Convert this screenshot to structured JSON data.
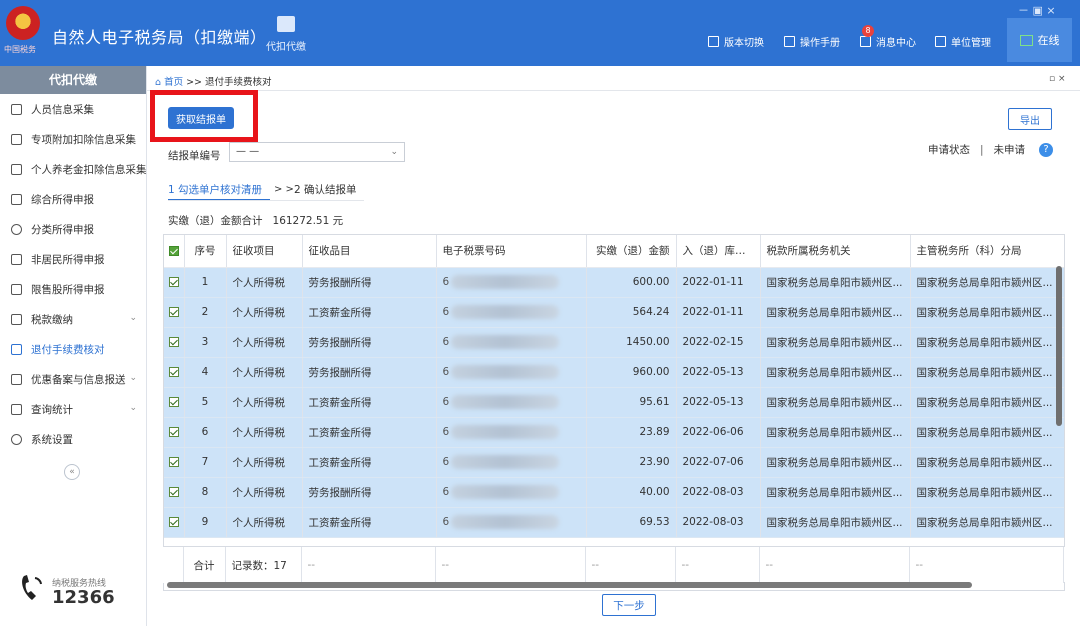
{
  "header": {
    "app_title": "自然人电子税务局（扣缴端）",
    "logo_text": "中国税务",
    "nav_tab": "代扣代缴",
    "version_switch": "版本切换",
    "manual": "操作手册",
    "messages": "消息中心",
    "message_count": "8",
    "unit_mgmt": "单位管理",
    "online": "在线",
    "win_controls": "－ ▣ ×",
    "colors": {
      "bar": "#2e72d2",
      "badge": "#e8413d"
    }
  },
  "sidebar": {
    "title": "代扣代缴",
    "items": [
      {
        "label": "人员信息采集",
        "icon": "person-icon"
      },
      {
        "label": "专项附加扣除信息采集",
        "icon": "list-icon"
      },
      {
        "label": "个人养老金扣除信息采集",
        "icon": "card-icon"
      },
      {
        "label": "综合所得申报",
        "icon": "layers-icon"
      },
      {
        "label": "分类所得申报",
        "icon": "clock-icon"
      },
      {
        "label": "非居民所得申报",
        "icon": "user-icon"
      },
      {
        "label": "限售股所得申报",
        "icon": "bar-chart-icon"
      },
      {
        "label": "税款缴纳",
        "icon": "wallet-icon"
      },
      {
        "label": "退付手续费核对",
        "icon": "doc-icon"
      },
      {
        "label": "优惠备案与信息报送",
        "icon": "folder-icon"
      },
      {
        "label": "查询统计",
        "icon": "search-list-icon"
      },
      {
        "label": "系统设置",
        "icon": "gear-icon"
      }
    ],
    "collapse": "«",
    "hotline_label": "纳税服务热线",
    "hotline_number": "12366"
  },
  "main": {
    "breadcrumb_home": "首页",
    "breadcrumb_sep": " >> ",
    "breadcrumb_current": "退付手续费核对",
    "window_controls": "▫ ×",
    "fetch_button": "获取结报单",
    "export_button": "导出",
    "report_no_label": "结报单编号",
    "report_no_value": "— —",
    "status_label": "申请状态",
    "status_value": "未申请",
    "help": "?",
    "step1": "1 勾选单户核对清册",
    "step_arrow": "> >",
    "step2": "2 确认结报单",
    "total_label": "实缴（退）金额合计",
    "total_value": "161272.51 元",
    "next_button": "下一步"
  },
  "table": {
    "columns": [
      "序号",
      "征收项目",
      "征收品目",
      "电子税票号码",
      "实缴（退）金额",
      "入（退）库日期",
      "税款所属税务机关",
      "主管税务所（科）分局"
    ],
    "rows": [
      {
        "no": "1",
        "item": "个人所得税",
        "sub": "劳务报酬所得",
        "ticket": "6",
        "amount": "600.00",
        "date": "2022-01-11",
        "office": "国家税务总局阜阳市颍州区...",
        "branch": "国家税务总局阜阳市颍州区..."
      },
      {
        "no": "2",
        "item": "个人所得税",
        "sub": "工资薪金所得",
        "ticket": "6",
        "amount": "564.24",
        "date": "2022-01-11",
        "office": "国家税务总局阜阳市颍州区...",
        "branch": "国家税务总局阜阳市颍州区..."
      },
      {
        "no": "3",
        "item": "个人所得税",
        "sub": "劳务报酬所得",
        "ticket": "6",
        "amount": "1450.00",
        "date": "2022-02-15",
        "office": "国家税务总局阜阳市颍州区...",
        "branch": "国家税务总局阜阳市颍州区..."
      },
      {
        "no": "4",
        "item": "个人所得税",
        "sub": "劳务报酬所得",
        "ticket": "6",
        "amount": "960.00",
        "date": "2022-05-13",
        "office": "国家税务总局阜阳市颍州区...",
        "branch": "国家税务总局阜阳市颍州区..."
      },
      {
        "no": "5",
        "item": "个人所得税",
        "sub": "工资薪金所得",
        "ticket": "6",
        "amount": "95.61",
        "date": "2022-05-13",
        "office": "国家税务总局阜阳市颍州区...",
        "branch": "国家税务总局阜阳市颍州区..."
      },
      {
        "no": "6",
        "item": "个人所得税",
        "sub": "工资薪金所得",
        "ticket": "6",
        "amount": "23.89",
        "date": "2022-06-06",
        "office": "国家税务总局阜阳市颍州区...",
        "branch": "国家税务总局阜阳市颍州区..."
      },
      {
        "no": "7",
        "item": "个人所得税",
        "sub": "工资薪金所得",
        "ticket": "6",
        "amount": "23.90",
        "date": "2022-07-06",
        "office": "国家税务总局阜阳市颍州区...",
        "branch": "国家税务总局阜阳市颍州区..."
      },
      {
        "no": "8",
        "item": "个人所得税",
        "sub": "劳务报酬所得",
        "ticket": "6",
        "amount": "40.00",
        "date": "2022-08-03",
        "office": "国家税务总局阜阳市颍州区...",
        "branch": "国家税务总局阜阳市颍州区..."
      },
      {
        "no": "9",
        "item": "个人所得税",
        "sub": "工资薪金所得",
        "ticket": "6",
        "amount": "69.53",
        "date": "2022-08-03",
        "office": "国家税务总局阜阳市颍州区...",
        "branch": "国家税务总局阜阳市颍州区..."
      }
    ],
    "summary": {
      "label": "合计",
      "records": "记录数：17",
      "dash": "--"
    }
  }
}
